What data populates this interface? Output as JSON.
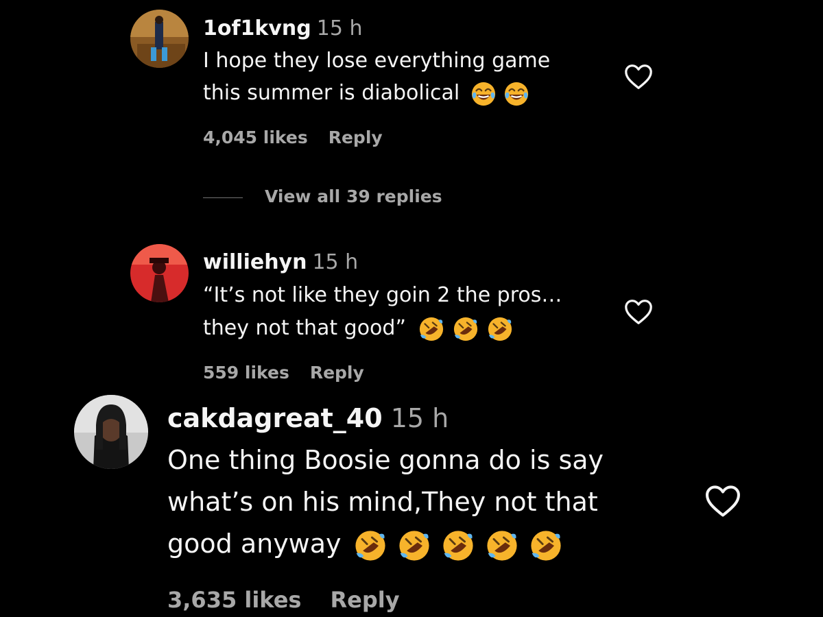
{
  "comments": [
    {
      "username": "1of1kvng",
      "time": "15 h",
      "text_lines": [
        "I hope they lose everything game",
        "this summer is diabolical"
      ],
      "emoji_count": 2,
      "emoji": "face-with-tears-of-joy-emoji",
      "likes": "4,045 likes",
      "reply": "Reply",
      "avatar": "user-photo-avatar",
      "heart": "heart-outline-icon"
    },
    {
      "username": "williehyn",
      "time": "15 h",
      "text_lines": [
        "“It’s not like they goin 2 the pros…",
        "they not that good”"
      ],
      "emoji_count": 3,
      "emoji": "rolling-on-floor-laughing-emoji",
      "likes": "559 likes",
      "reply": "Reply",
      "avatar": "user-photo-avatar",
      "heart": "heart-outline-icon"
    },
    {
      "username": "cakdagreat_40",
      "time": "15 h",
      "text_lines": [
        "One thing Boosie gonna do is say",
        "what’s on his mind,They not that",
        "good anyway"
      ],
      "emoji_count": 5,
      "emoji": "rolling-on-floor-laughing-emoji",
      "likes": "3,635 likes",
      "reply": "Reply",
      "avatar": "user-photo-avatar",
      "heart": "heart-outline-icon"
    }
  ],
  "view_replies": "View all 39 replies",
  "colors": {
    "background": "#000000",
    "primary_text": "#f5f5f5",
    "secondary_text": "#a8a8a8",
    "emoji_face": "#f7b32b"
  }
}
